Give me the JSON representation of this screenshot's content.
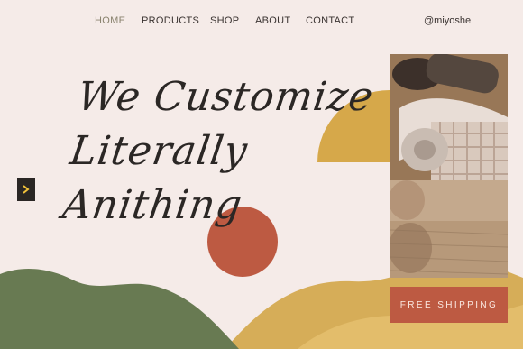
{
  "nav": {
    "items": [
      {
        "label": "HOME",
        "active": true
      },
      {
        "label": "PRODUCTS"
      },
      {
        "label": "SHOP"
      },
      {
        "label": "ABOUT"
      },
      {
        "label": "CONTACT"
      }
    ],
    "handle": "@miyoshe"
  },
  "hero": {
    "line1": "We Customize",
    "line2": "Literally",
    "line3": "Anithing"
  },
  "cta": {
    "free_shipping": "FREE SHIPPING"
  },
  "icons": {
    "next": "chevron-right-icon"
  },
  "colors": {
    "background": "#f5ebe8",
    "mustard": "#d6a84a",
    "terracotta": "#bd5a42",
    "olive": "#687a52",
    "dark": "#2a2624",
    "nav_active": "#8a836f"
  }
}
